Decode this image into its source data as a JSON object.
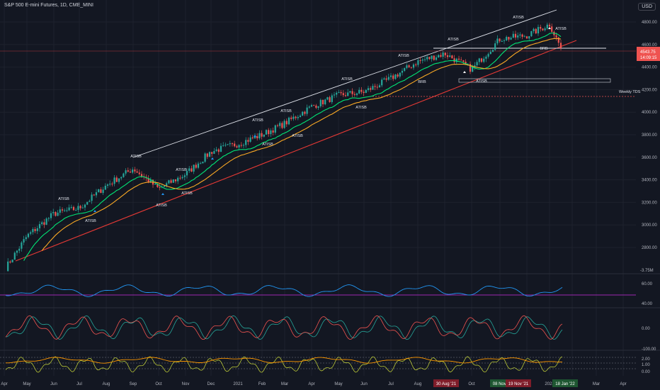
{
  "header": {
    "symbol_title": "S&P 500 E-mini Futures, 1D, CME_MINI",
    "currency": "USD"
  },
  "colors": {
    "background": "#131722",
    "bull": "#26a69a",
    "bear": "#ef5350",
    "upper_trendline": "#e0e3eb",
    "lower_trendline": "#e53935",
    "ma_fast": "#00e676",
    "ma_slow": "#f9a825",
    "oscillator_1": "#2196f3",
    "oscillator_level": "#9c27b0",
    "oscillator_2_a": "#26a69a",
    "oscillator_2_b": "#ef5350",
    "oscillator_3_a": "#cddc39",
    "oscillator_3_b": "#ff9800"
  },
  "price_axis": {
    "labels": [
      "4800.00",
      "4600.00",
      "4400.00",
      "4200.00",
      "4000.00",
      "3800.00",
      "3600.00",
      "3400.00",
      "3200.00",
      "3000.00",
      "2800.00"
    ],
    "current_price": "4543.75",
    "countdown": "14:09:15"
  },
  "annotations": {
    "weekly_tds": "Weekly TDS",
    "patterns": [
      "ATISB",
      "ATISB",
      "ATISB",
      "ATISB",
      "ATISB",
      "ATISB",
      "ATISB",
      "ATISB",
      "ATISB",
      "ATISB",
      "ATISB",
      "ATISB",
      "ATISB",
      "ATISB",
      "ATISB",
      "ATISB",
      "BRB",
      "BRB",
      "ATISB"
    ]
  },
  "panes": {
    "volume_label": "-3.75M",
    "osc1_labels": [
      "60.00",
      "40.00"
    ],
    "osc2_labels": [
      "0.00",
      "-100.00"
    ],
    "osc3_labels": [
      "2.00",
      "1.00",
      "0.00"
    ]
  },
  "time_axis": {
    "labels": [
      "Apr",
      "May",
      "Jun",
      "Jul",
      "Aug",
      "Sep",
      "Oct",
      "Nov",
      "Dec",
      "2021",
      "Feb",
      "Mar",
      "Apr",
      "May",
      "Jun",
      "Jul",
      "Aug",
      "Sep",
      "Oct",
      "Nov",
      "Dec",
      "2022",
      "Feb",
      "Mar",
      "Apr"
    ],
    "highlights": [
      "30 Aug '21",
      "08 Nov '21",
      "19 Nov '21",
      "18 Jan '22"
    ]
  },
  "chart_data": {
    "type": "line",
    "title": "S&P 500 E-mini Futures, 1D, CME_MINI",
    "xlabel": "",
    "ylabel": "",
    "ylim": [
      2600,
      4900
    ],
    "x": [
      "Apr",
      "May",
      "Jun",
      "Jul",
      "Aug",
      "Sep",
      "Oct",
      "Nov",
      "Dec",
      "2021",
      "Feb",
      "Mar",
      "Apr",
      "May",
      "Jun",
      "Jul",
      "Aug",
      "Sep",
      "Oct",
      "Nov",
      "Dec",
      "2022",
      "Jan 18"
    ],
    "series": [
      {
        "name": "",
        "values": [
          2620,
          2900,
          3100,
          3150,
          3350,
          3500,
          3320,
          3450,
          3650,
          3720,
          3800,
          3900,
          4050,
          4150,
          4180,
          4300,
          4450,
          4520,
          4380,
          4650,
          4680,
          4780,
          4543.75
        ]
      }
    ],
    "grid": true,
    "legend": "none"
  }
}
